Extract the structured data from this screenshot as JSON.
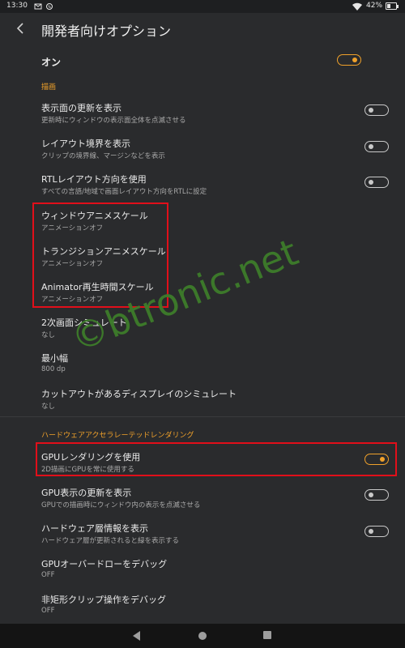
{
  "status_bar": {
    "time": "13:30",
    "battery_text": "42%",
    "battery_level": 0.42
  },
  "app_bar": {
    "title": "開発者向けオプション"
  },
  "master": {
    "label": "オン",
    "enabled": true
  },
  "sections": {
    "drawing": "描画",
    "hw_rendering": "ハードウェアアクセラレーテッドレンダリング"
  },
  "items": [
    {
      "title": "表示面の更新を表示",
      "summary": "更新時にウィンドウの表示面全体を点滅させる",
      "toggle": "off"
    },
    {
      "title": "レイアウト境界を表示",
      "summary": "クリップの境界線、マージンなどを表示",
      "toggle": "off"
    },
    {
      "title": "RTLレイアウト方向を使用",
      "summary": "すべての言語/地域で画面レイアウト方向をRTLに設定",
      "toggle": "off"
    },
    {
      "title": "ウィンドウアニメスケール",
      "summary": "アニメーションオフ"
    },
    {
      "title": "トランジションアニメスケール",
      "summary": "アニメーションオフ"
    },
    {
      "title": "Animator再生時間スケール",
      "summary": "アニメーションオフ"
    },
    {
      "title": "2次画面シミュレート",
      "summary": "なし"
    },
    {
      "title": "最小幅",
      "summary": "800 dp"
    },
    {
      "title": "カットアウトがあるディスプレイのシミュレート",
      "summary": "なし"
    },
    {
      "title": "GPUレンダリングを使用",
      "summary": "2D描画にGPUを常に使用する",
      "toggle": "on"
    },
    {
      "title": "GPU表示の更新を表示",
      "summary": "GPUでの描画時にウィンドウ内の表示を点滅させる",
      "toggle": "off"
    },
    {
      "title": "ハードウェア層情報を表示",
      "summary": "ハードウェア層が更新されると緑を表示する",
      "toggle": "off"
    },
    {
      "title": "GPUオーバードローをデバッグ",
      "summary": "OFF"
    },
    {
      "title": "非矩形クリップ操作をデバッグ",
      "summary": "OFF"
    }
  ],
  "watermark": "©btronic.net",
  "colors": {
    "accent": "#f0a12a",
    "highlight": "#e10f1a",
    "watermark": "#3d7d2a"
  }
}
